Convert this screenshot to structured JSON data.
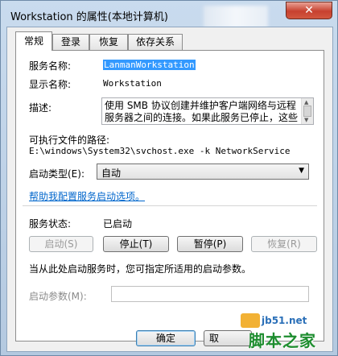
{
  "window": {
    "title": "Workstation 的属性(本地计算机)",
    "close_symbol": "✕"
  },
  "tabs": [
    {
      "label": "常规",
      "active": true
    },
    {
      "label": "登录",
      "active": false
    },
    {
      "label": "恢复",
      "active": false
    },
    {
      "label": "依存关系",
      "active": false
    }
  ],
  "general": {
    "service_name_label": "服务名称:",
    "service_name_value": "LanmanWorkstation",
    "display_name_label": "显示名称:",
    "display_name_value": "Workstation",
    "description_label": "描述:",
    "description_value": "使用 SMB 协议创建并维护客户端网络与远程服务器之间的连接。如果此服务已停止，这些连",
    "exe_path_label": "可执行文件的路径:",
    "exe_path_value": "E:\\windows\\System32\\svchost.exe -k NetworkService",
    "startup_type_label": "启动类型(E):",
    "startup_type_value": "自动",
    "help_link": "帮助我配置服务启动选项。",
    "service_status_label": "服务状态:",
    "service_status_value": "已启动",
    "hint_text": "当从此处启动服务时，您可指定所适用的启动参数。",
    "start_params_label": "启动参数(M):",
    "start_params_value": ""
  },
  "buttons": {
    "start": "启动(S)",
    "stop": "停止(T)",
    "pause": "暂停(P)",
    "resume": "恢复(R)",
    "ok": "确定",
    "cancel": "取"
  },
  "watermark": {
    "url": "jb51.net",
    "name": "脚本之家"
  },
  "colors": {
    "selection": "#3399ff",
    "link": "#0066cc",
    "close": "#c7412f"
  }
}
